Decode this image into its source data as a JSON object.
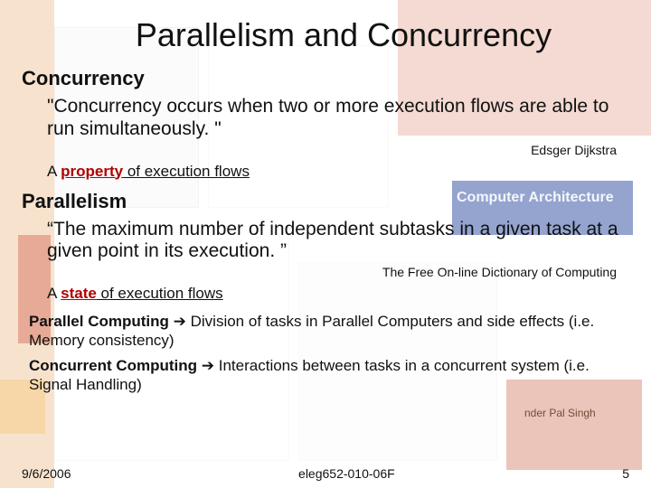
{
  "title": "Parallelism and Concurrency",
  "section1": {
    "heading": "Concurrency",
    "quote": "\"Concurrency occurs when two or more execution flows are able to run simultaneously. \"",
    "attribution": "Edsger Dijkstra",
    "sub_prefix": "A ",
    "sub_keyword": "property",
    "sub_suffix": " of execution flows"
  },
  "section2": {
    "heading": "Parallelism",
    "quote": "“The maximum number of independent subtasks in a given task at a given point in its execution. ”",
    "attribution": "The Free On-line Dictionary of Computing",
    "sub_prefix": "A ",
    "sub_keyword": "state",
    "sub_suffix": " of execution flows"
  },
  "note1": {
    "term": "Parallel Computing",
    "arrow": " ➔ ",
    "rest": "Division of tasks in Parallel Computers and side effects (i.e. Memory consistency)"
  },
  "note2": {
    "term": "Concurrent Computing",
    "arrow": " ➔ ",
    "rest": "Interactions between tasks in a concurrent system (i.e. Signal Handling)"
  },
  "footer": {
    "date": "9/6/2006",
    "course": "eleg652-010-06F",
    "page": "5"
  },
  "bg": {
    "arch_label": "Computer Architecture",
    "author_label": "nder Pal Singh"
  }
}
